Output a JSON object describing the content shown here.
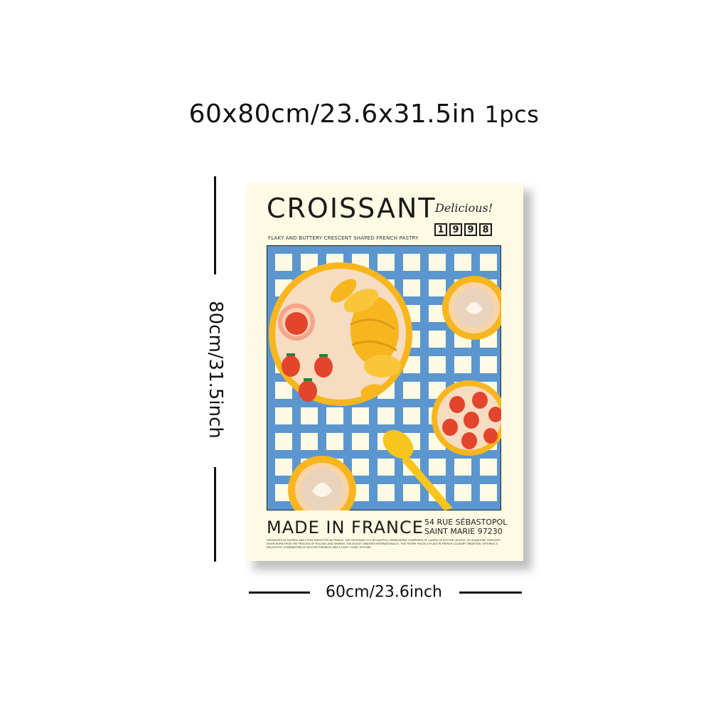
{
  "size_title": "60x80cm/23.6x31.5in",
  "quantity": "1pcs",
  "height_label": "80cm/31.5inch",
  "width_label": "60cm/23.6inch",
  "poster": {
    "title": "CROISSANT",
    "tagline": "Delicious!",
    "year_digits": [
      "1",
      "9",
      "9",
      "8"
    ],
    "subtitle": "FLAKY AND BUTTERY CRESCENT SHAPED FRENCH PASTRY",
    "footer_title": "MADE IN FRANCE",
    "address_line1": "54 RUE SÉBASTOPOL",
    "address_line2": "SAINT MARIE 97230",
    "body_text": "Originated in Austria and later perfected in France, the croissant is a delightful viennoiserie comprised of layers of buttery dough, its signature crescent shape born from the process of rolling and shaping the dough. Enjoyed internationally, this pastry holds a place in French culinary tradition, offering a delightful combination of rich butteriness and a light, flaky texture.",
    "colors": {
      "background": "#fdfbe4",
      "gingham_blue": "#5b96cf",
      "plate_yellow": "#f7b61e",
      "plate_inner": "#f6dcc0",
      "strawberry": "#e2452c",
      "coffee": "#e9d3bd"
    }
  }
}
